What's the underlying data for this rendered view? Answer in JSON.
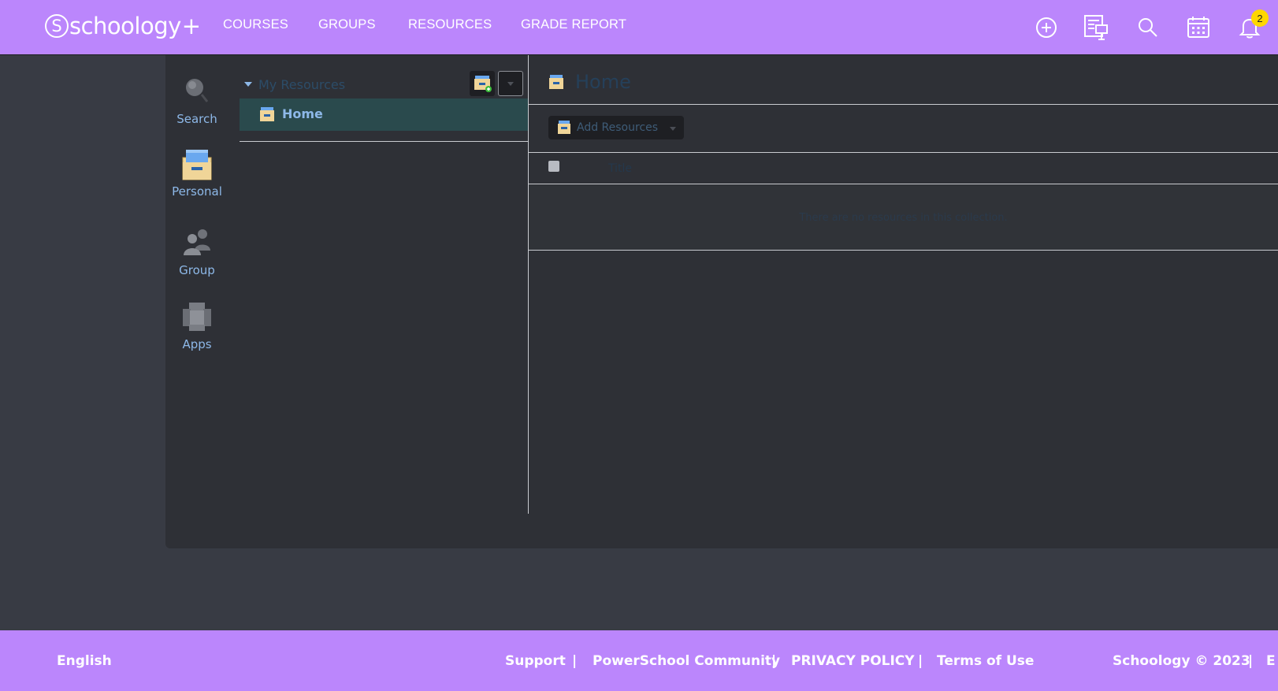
{
  "header": {
    "logo": {
      "text": "schoology",
      "plus": "+"
    },
    "nav": [
      "COURSES",
      "GROUPS",
      "RESOURCES",
      "GRADE REPORT"
    ],
    "icons": [
      "plus-circle-icon",
      "resources-icon",
      "search-icon",
      "calendar-icon",
      "bell-icon"
    ],
    "notifications_count": "2"
  },
  "leftnav": {
    "items": [
      {
        "label": "Search",
        "icon": "search-icon"
      },
      {
        "label": "Personal",
        "icon": "personal-folder-icon"
      },
      {
        "label": "Group",
        "icon": "group-icon"
      },
      {
        "label": "Apps",
        "icon": "apps-icon"
      }
    ]
  },
  "tree": {
    "title": "My Resources",
    "home_label": "Home"
  },
  "content": {
    "title": "Home",
    "add_resources_label": "Add Resources",
    "column_title": "Title",
    "empty_message": "There are no resources in this collection."
  },
  "footer": {
    "language": "English",
    "links": [
      "Support",
      "PowerSchool Community",
      "PRIVACY POLICY",
      "Terms of Use"
    ],
    "separator": "|",
    "copyright": "Schoology © 2023",
    "trailing": "E"
  },
  "colors": {
    "brand_purple": "#bb86fc",
    "panel_bg": "#2e3036",
    "page_bg": "#383b44",
    "link_blue": "#8db8e8",
    "badge_yellow": "#ffd600"
  }
}
